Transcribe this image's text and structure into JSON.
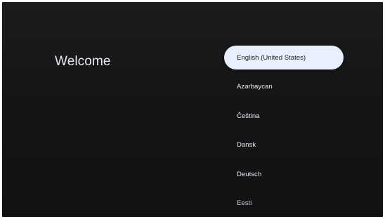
{
  "welcome": {
    "title": "Welcome"
  },
  "languages": {
    "items": [
      {
        "label": "English (United States)",
        "selected": true
      },
      {
        "label": "Azərbaycan",
        "selected": false
      },
      {
        "label": "Čeština",
        "selected": false
      },
      {
        "label": "Dansk",
        "selected": false
      },
      {
        "label": "Deutsch",
        "selected": false
      },
      {
        "label": "Eesti",
        "selected": false
      }
    ]
  },
  "colors": {
    "background": "#141516",
    "selected_bg": "#e8f0fe",
    "selected_text": "#202124",
    "text": "#e8eaed"
  }
}
